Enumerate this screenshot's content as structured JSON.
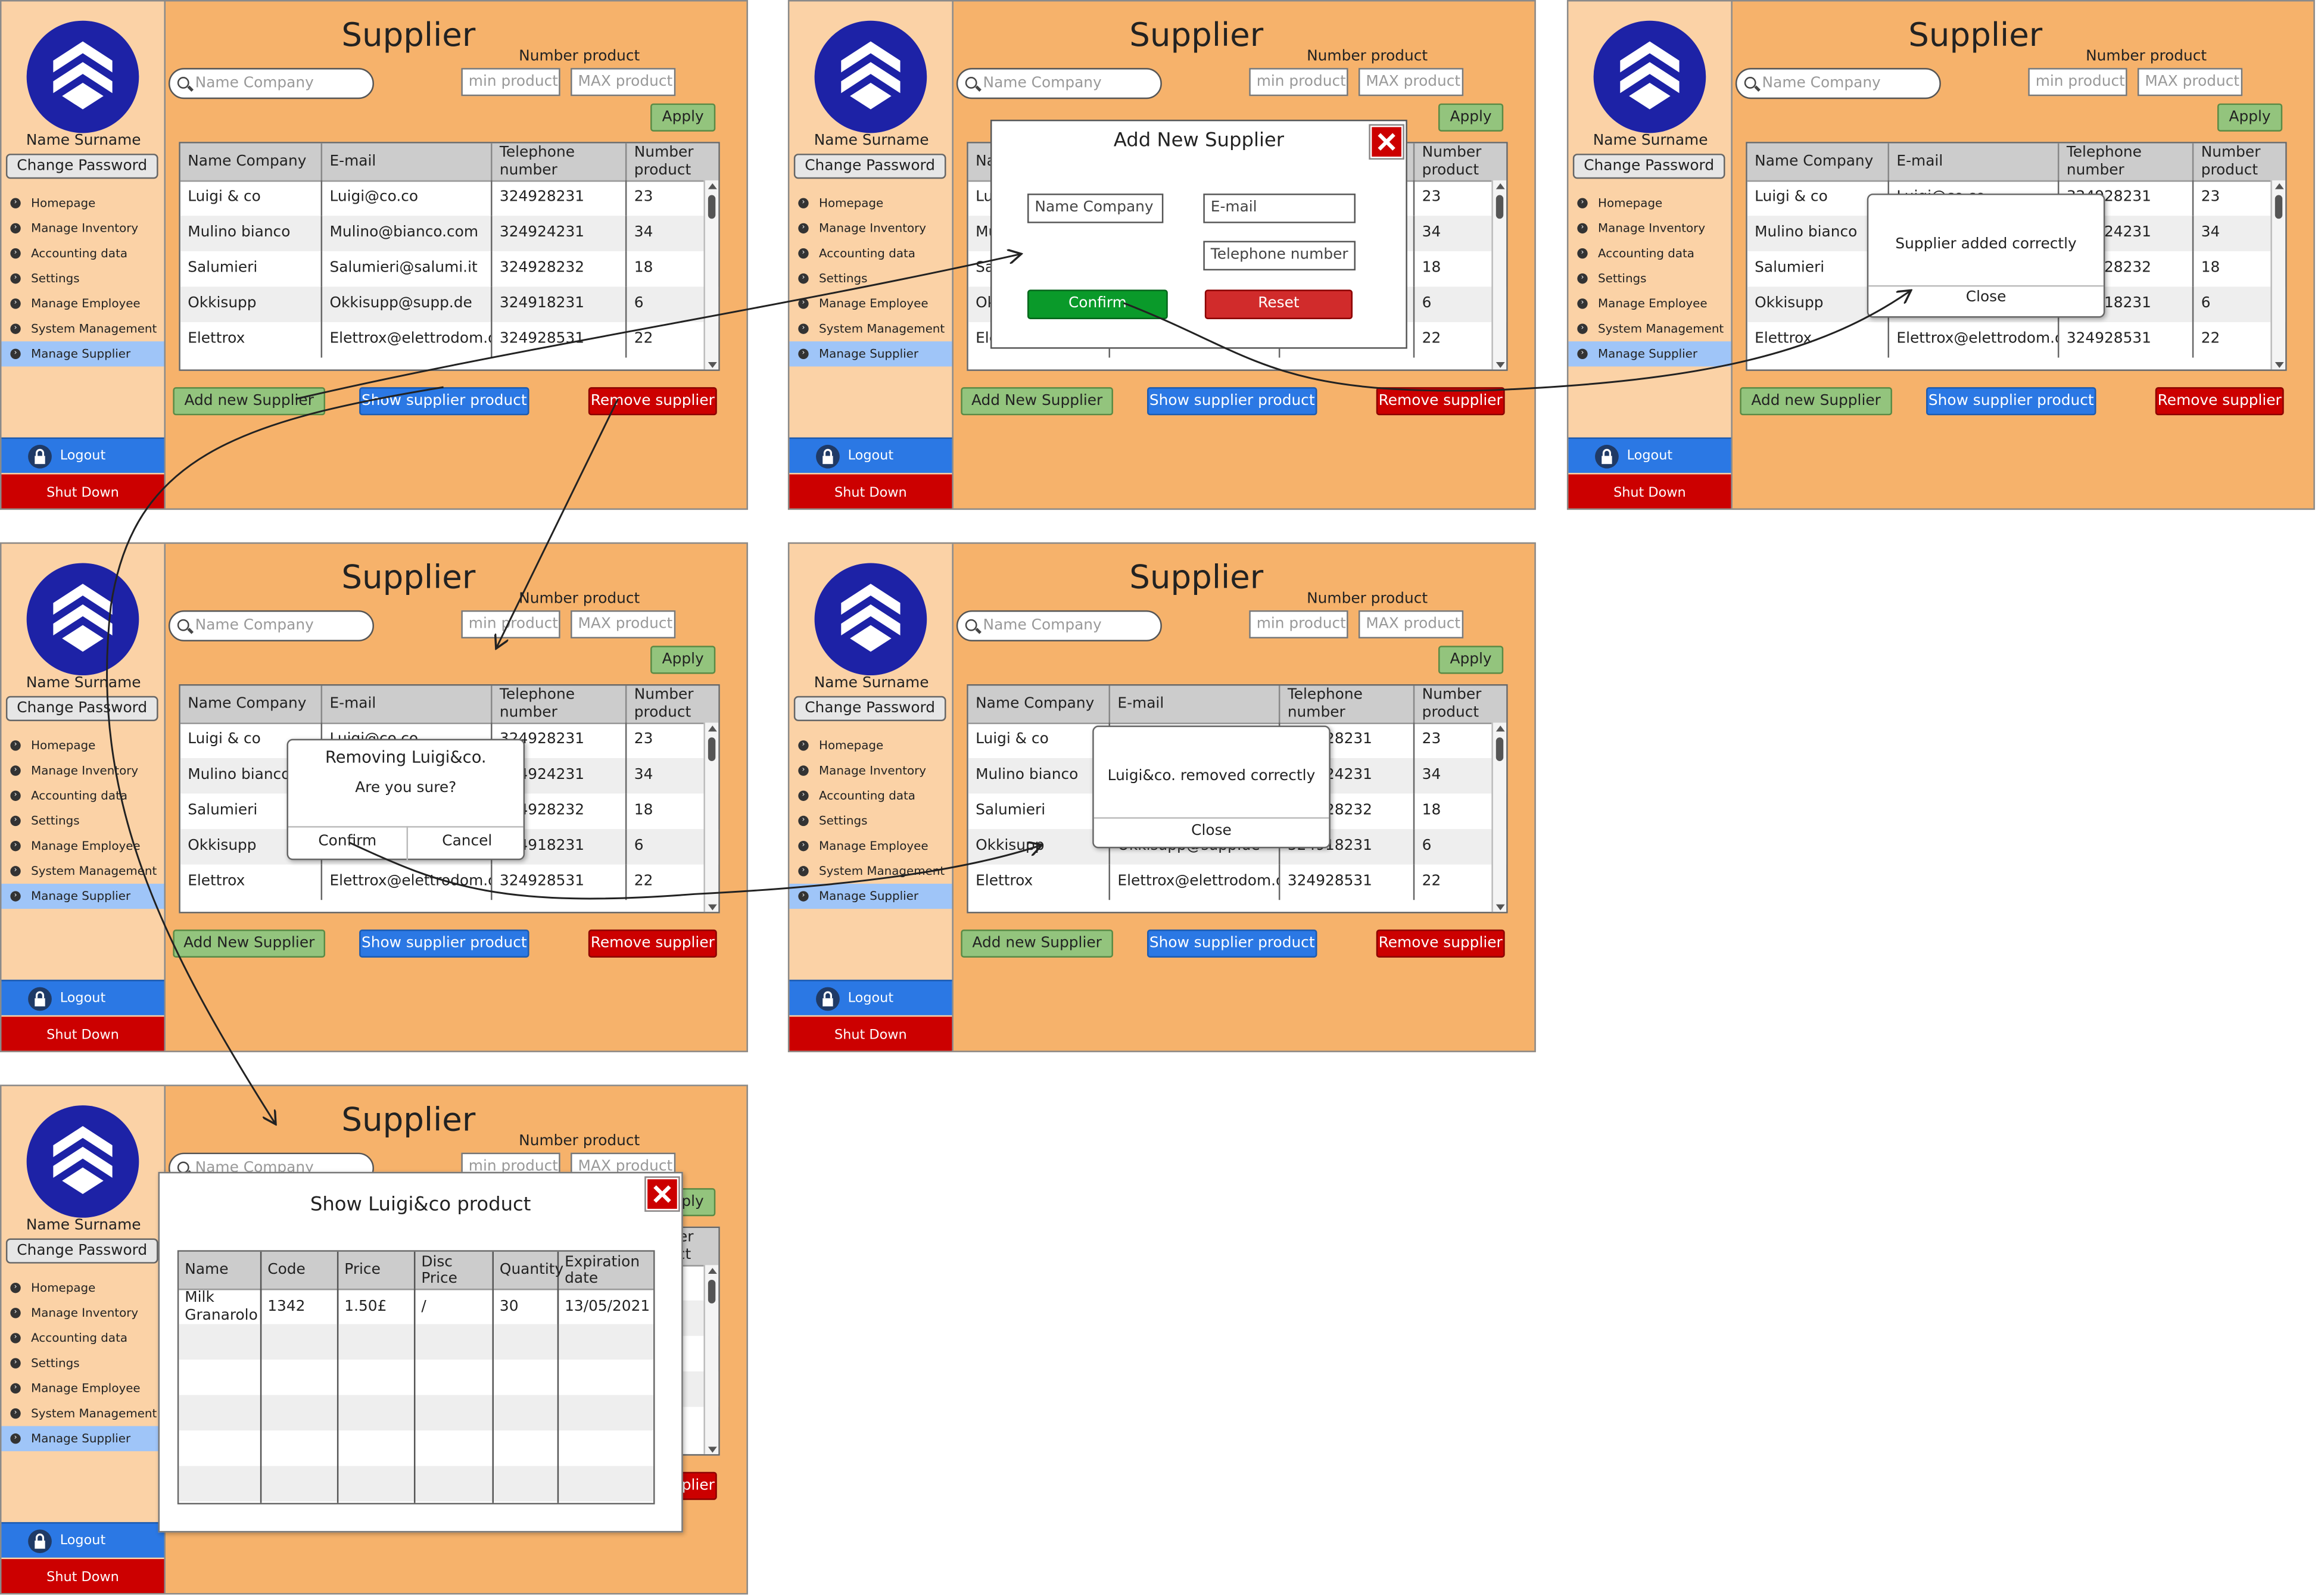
{
  "app": {
    "title": "Supplier",
    "user_name": "Name Surname",
    "change_password": "Change Password",
    "logout": "Logout",
    "shutdown": "Shut Down",
    "nav": [
      "Homepage",
      "Manage Inventory",
      "Accounting data",
      "Settings",
      "Manage Employee",
      "System Management",
      "Manage Supplier"
    ],
    "active_nav": "Manage Supplier"
  },
  "filters": {
    "search_placeholder": "Name Company",
    "number_product_label": "Number product",
    "min_placeholder": "min product",
    "max_placeholder": "MAX product",
    "apply": "Apply"
  },
  "table": {
    "headers": [
      "Name Company",
      "E-mail",
      "Telephone number",
      "Number product"
    ],
    "rows": [
      [
        "Luigi & co",
        "Luigi@co.co",
        "324928231",
        "23"
      ],
      [
        "Mulino bianco",
        "Mulino@bianco.com",
        "324924231",
        "34"
      ],
      [
        "Salumieri",
        "Salumieri@salumi.it",
        "324928232",
        "18"
      ],
      [
        "Okkisupp",
        "Okkisupp@supp.de",
        "324918231",
        "6"
      ],
      [
        "Elettrox",
        "Elettrox@elettrodom.de",
        "324928531",
        "22"
      ]
    ]
  },
  "buttons": {
    "add_a": "Add new Supplier",
    "add_b": "Add New Supplier",
    "add_c": "Add new Supplier",
    "show": "Show supplier product",
    "remove": "Remove supplier"
  },
  "dialog_add": {
    "title": "Add New Supplier",
    "name_placeholder": "Name Company",
    "email_placeholder": "E-mail",
    "phone_placeholder": "Telephone number",
    "confirm": "Confirm",
    "reset": "Reset"
  },
  "dialog_added": {
    "message": "Supplier added correctly",
    "close": "Close"
  },
  "dialog_remove": {
    "title": "Removing Luigi&co.",
    "message": "Are you sure?",
    "confirm": "Confirm",
    "cancel": "Cancel"
  },
  "dialog_removed": {
    "message": "Luigi&co. removed correctly",
    "close": "Close"
  },
  "dialog_products": {
    "title": "Show Luigi&co product",
    "headers": [
      "Name",
      "Code",
      "Price",
      "Disc Price",
      "Quantity",
      "Expiration date"
    ],
    "rows": [
      [
        "Milk Granarolo",
        "1342",
        "1.50£",
        "/",
        "30",
        "13/05/2021"
      ]
    ]
  },
  "colors": {
    "background": "#f6b26b",
    "sidebar": "#fbd2a6",
    "primary": "#2b78e4",
    "danger": "#cc0000",
    "success": "#93c47d",
    "logo": "#1d22a6"
  }
}
